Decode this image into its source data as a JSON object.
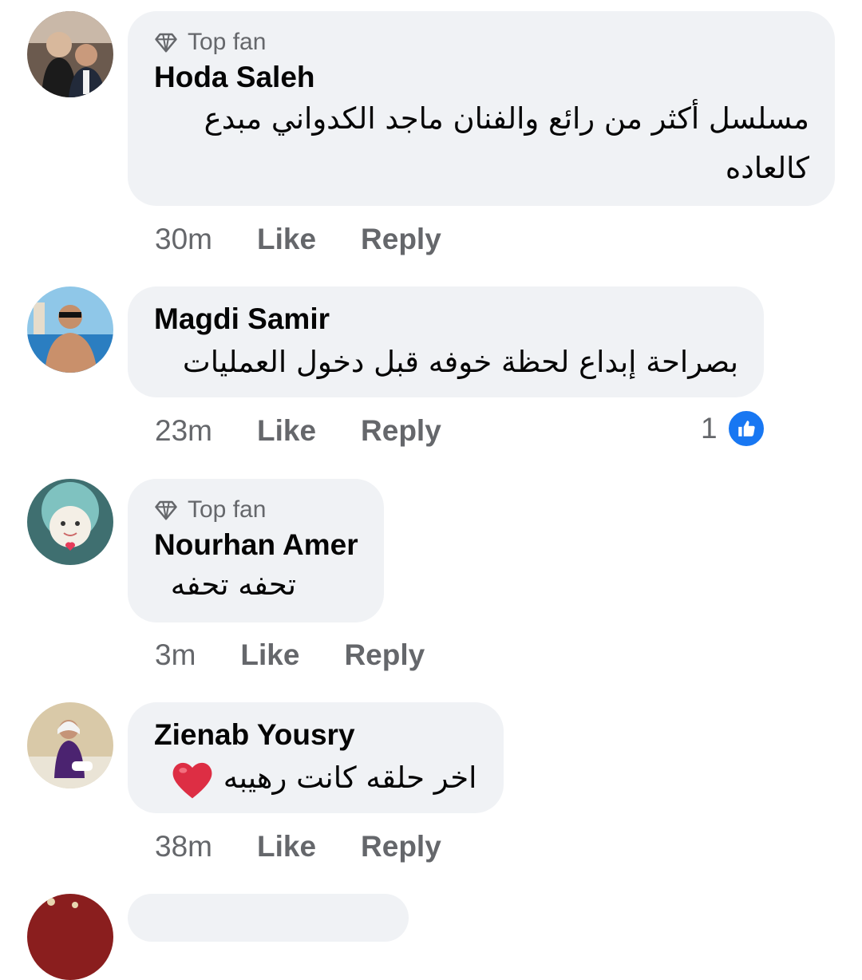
{
  "comments": [
    {
      "badge": "Top fan",
      "author": "Hoda Saleh",
      "text_line1": "مسلسل أكثر من رائع والفنان ماجد الكدواني مبدع",
      "text_line2": "كالعاده",
      "time": "30m",
      "like": "Like",
      "reply": "Reply"
    },
    {
      "author": "Magdi Samir",
      "text": "بصراحة إبداع لحظة خوفه قبل دخول العمليات",
      "time": "23m",
      "like": "Like",
      "reply": "Reply",
      "reaction_count": "1"
    },
    {
      "badge": "Top fan",
      "author": "Nourhan Amer",
      "text": "تحفه تحفه",
      "time": "3m",
      "like": "Like",
      "reply": "Reply"
    },
    {
      "author": "Zienab Yousry",
      "text": "اخر حلقه كانت رهيبه",
      "emoji": "red-heart",
      "time": "38m",
      "like": "Like",
      "reply": "Reply"
    }
  ],
  "icons": {
    "top_fan": "diamond-icon",
    "reaction": "thumbs-up-icon",
    "like_color": "#1877f2",
    "heart_color": "#dd2e44"
  }
}
